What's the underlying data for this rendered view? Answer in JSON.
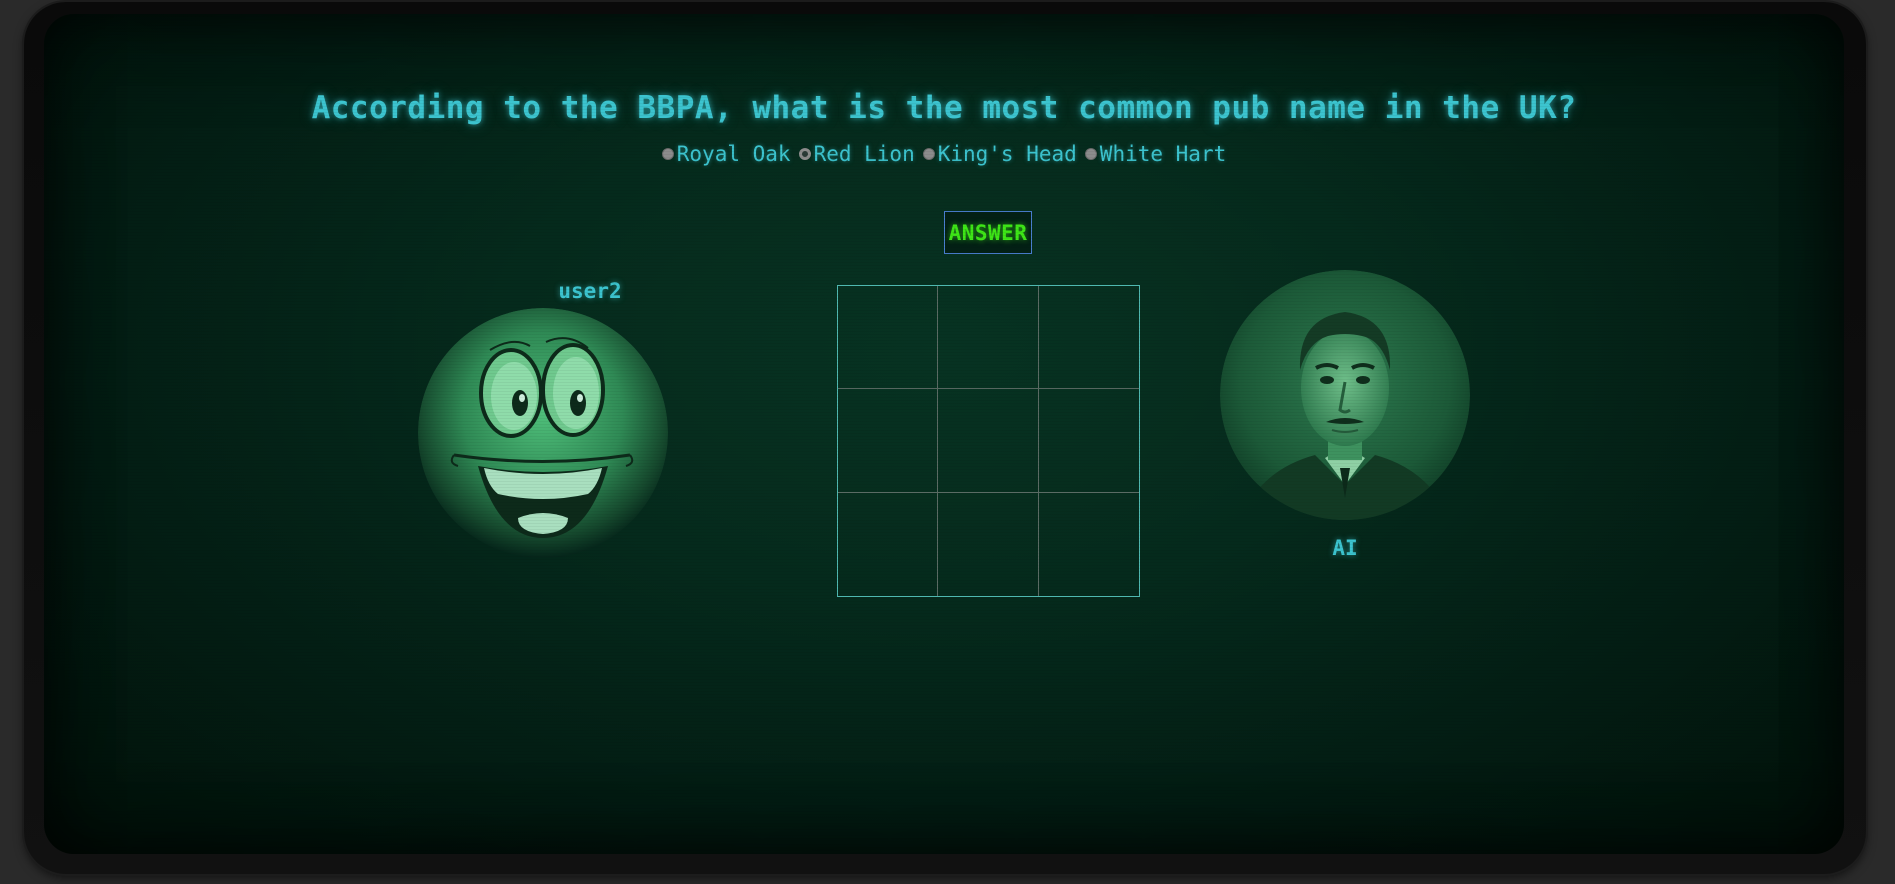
{
  "question": {
    "text": "According to the BBPA, what is the most common pub name in the UK?"
  },
  "options": [
    {
      "label": "Royal Oak",
      "selected": false
    },
    {
      "label": "Red Lion",
      "selected": true
    },
    {
      "label": "King's Head",
      "selected": false
    },
    {
      "label": "White Hart",
      "selected": false
    }
  ],
  "answer_button": {
    "label": "ANSWER"
  },
  "players": {
    "left": {
      "name": "user2",
      "avatar": "cartoon-smiley-face"
    },
    "right": {
      "name": "AI",
      "avatar": "man-portrait"
    }
  },
  "board": {
    "cells": [
      "",
      "",
      "",
      "",
      "",
      "",
      "",
      "",
      ""
    ]
  },
  "colors": {
    "text_cyan": "#3cc4cf",
    "button_text_green": "#3ee617",
    "screen_green": "#052a1c"
  }
}
